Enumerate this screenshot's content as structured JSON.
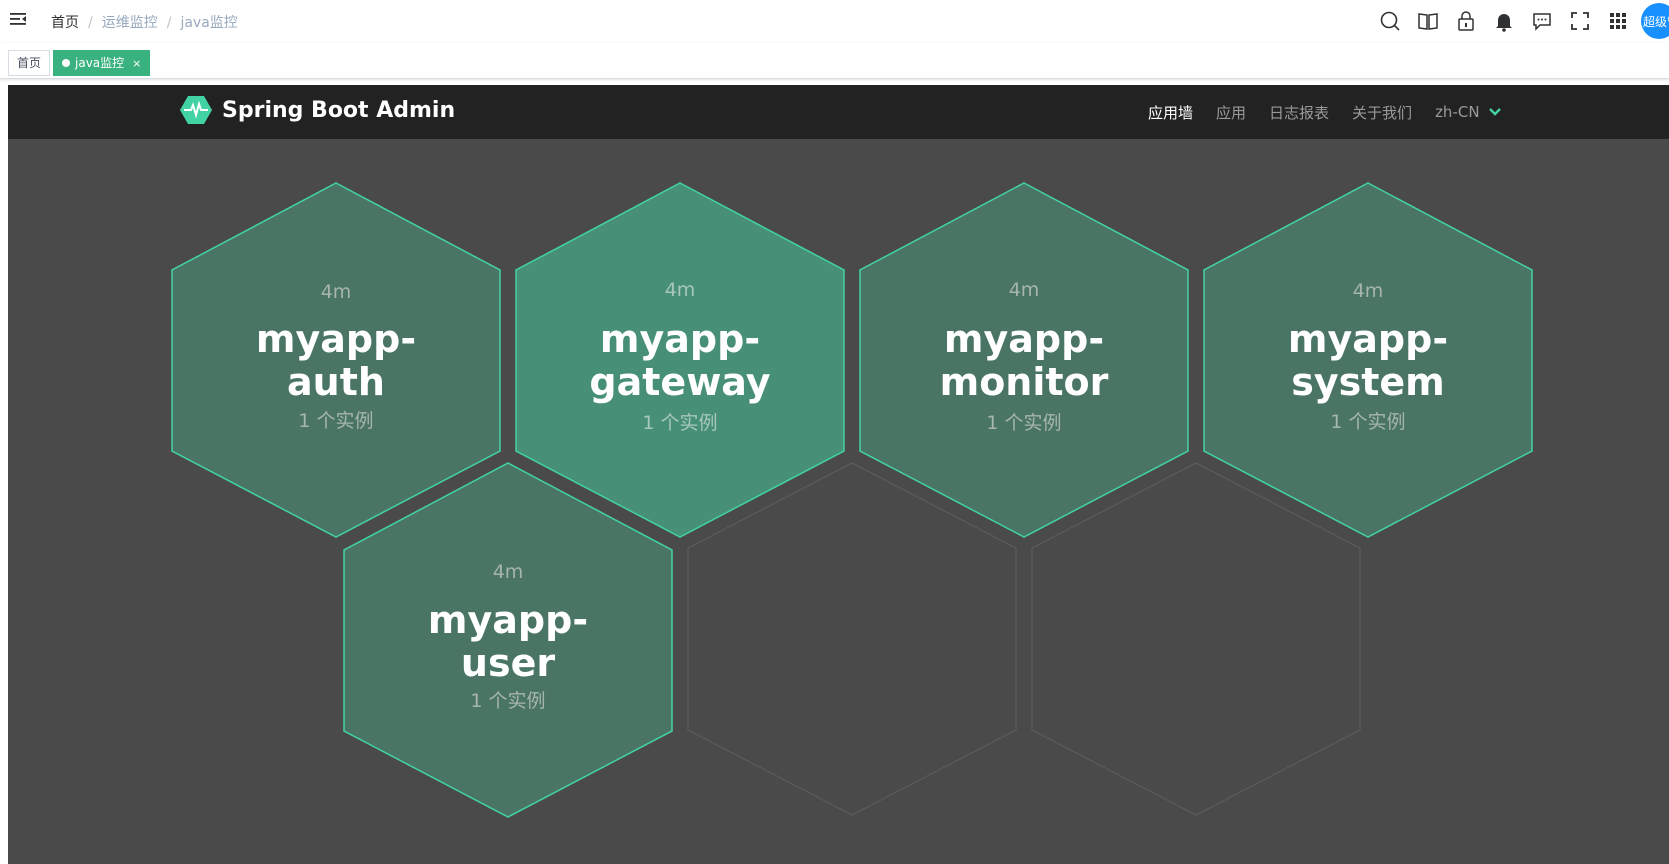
{
  "breadcrumb": {
    "home": "首页",
    "parent": "运维监控",
    "current": "java监控"
  },
  "user": {
    "avatar_text": "超级管理员"
  },
  "tags": {
    "home": "首页",
    "active": "java监控",
    "close": "×"
  },
  "sba": {
    "title": "Spring Boot Admin",
    "menu": {
      "wall": "应用墙",
      "apps": "应用",
      "journal": "日志报表",
      "about": "关于我们",
      "lang": "zh-CN"
    }
  },
  "apps": [
    {
      "age": "4m",
      "name1": "myapp-",
      "name2": "auth",
      "instances": "1 个实例"
    },
    {
      "age": "4m",
      "name1": "myapp-",
      "name2": "gateway",
      "instances": "1 个实例"
    },
    {
      "age": "4m",
      "name1": "myapp-",
      "name2": "monitor",
      "instances": "1 个实例"
    },
    {
      "age": "4m",
      "name1": "myapp-",
      "name2": "system",
      "instances": "1 个实例"
    },
    {
      "age": "4m",
      "name1": "myapp-",
      "name2": "user",
      "instances": "1 个实例"
    }
  ],
  "colors": {
    "accent": "#42d3a5",
    "hex_fill": "#4a7565",
    "hex_fill_hover": "#479077",
    "frame_bg": "#4a4a4a",
    "tag_active": "#3ab27f",
    "avatar": "#1890ff"
  }
}
